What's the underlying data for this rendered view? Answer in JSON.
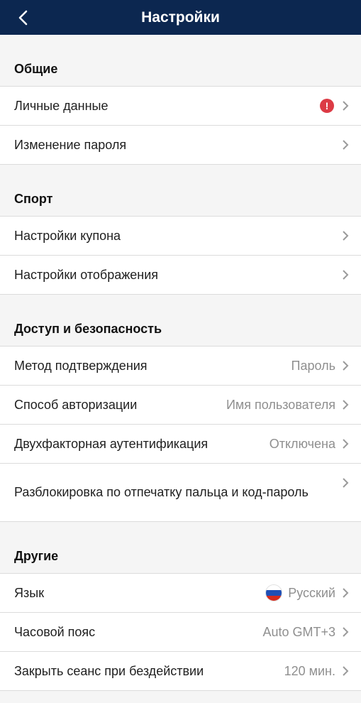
{
  "header": {
    "title": "Настройки",
    "back_icon": "chevron-left-icon"
  },
  "sections": {
    "general": {
      "title": "Общие",
      "items": {
        "personal": {
          "label": "Личные данные",
          "alert": "!"
        },
        "password": {
          "label": "Изменение пароля"
        }
      }
    },
    "sport": {
      "title": "Спорт",
      "items": {
        "coupon": {
          "label": "Настройки купона"
        },
        "display": {
          "label": "Настройки отображения"
        }
      }
    },
    "security": {
      "title": "Доступ и безопасность",
      "items": {
        "confirm_method": {
          "label": "Метод подтверждения",
          "value": "Пароль"
        },
        "auth_method": {
          "label": "Способ авторизации",
          "value": "Имя пользователя"
        },
        "two_factor": {
          "label": "Двухфакторная аутентификация",
          "value": "Отключена"
        },
        "fingerprint": {
          "label": "Разблокировка по отпечатку пальца и код-пароль"
        }
      }
    },
    "other": {
      "title": "Другие",
      "items": {
        "language": {
          "label": "Язык",
          "value": "Русский",
          "flag_colors": [
            "#ffffff",
            "#1f4fb5",
            "#d52b1e"
          ]
        },
        "timezone": {
          "label": "Часовой пояс",
          "value": "Auto GMT+3"
        },
        "session": {
          "label": "Закрыть сеанс при бездействии",
          "value": "120 мин."
        }
      }
    }
  },
  "colors": {
    "header_bg": "#0c2750",
    "alert": "#dc3b45",
    "muted": "#8f8f8f"
  }
}
